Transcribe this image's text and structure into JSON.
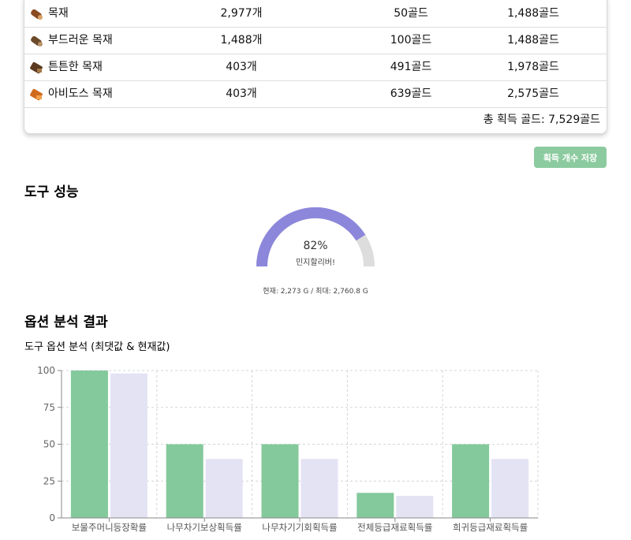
{
  "table": {
    "rows": [
      {
        "name": "목재",
        "count": "2,977개",
        "price": "50골드",
        "total": "1,488골드",
        "icon": "log-icon",
        "icon_color": "#8a4a22"
      },
      {
        "name": "부드러운 목재",
        "count": "1,488개",
        "price": "100골드",
        "total": "1,488골드",
        "icon": "soft-log-icon",
        "icon_color": "#6b4a2a"
      },
      {
        "name": "튼튼한 목재",
        "count": "403개",
        "price": "491골드",
        "total": "1,978골드",
        "icon": "sturdy-log-icon",
        "icon_color": "#5a3a20"
      },
      {
        "name": "아비도스 목재",
        "count": "403개",
        "price": "639골드",
        "total": "2,575골드",
        "icon": "abidos-log-icon",
        "icon_color": "#d06a1a"
      }
    ],
    "total_text": "총 획득 골드: 7,529골드"
  },
  "save_button_label": "획득 개수 저장",
  "tool_section": {
    "title": "도구 성능",
    "gauge_percent_text": "82%",
    "gauge_value": 0.82,
    "gauge_label": "민지할리버!",
    "current_text": "현재: 2,273 G / 최대: 2,760.8 G",
    "fill_color": "#8c87db",
    "track_color": "#dddddd"
  },
  "option_section": {
    "title": "옵션 분석 결과",
    "chart_title": "도구 옵션 분석 (최댓값 & 현재값)"
  },
  "chart_data": {
    "type": "bar",
    "title": "도구 옵션 분석 (최댓값 & 현재값)",
    "categories": [
      "보물주머니등장확률",
      "나무차기보상획득률",
      "나무차기기회획득률",
      "전체등급재료획득률",
      "희귀등급재료획득률"
    ],
    "series": [
      {
        "values": [
          100,
          50,
          50,
          17,
          50
        ],
        "color": "#84c99b"
      },
      {
        "values": [
          98,
          40,
          40,
          15,
          40
        ],
        "color": "#e4e3f4"
      }
    ],
    "ylim": [
      0,
      100
    ],
    "yticks": [
      0,
      25,
      50,
      75,
      100
    ],
    "grid": true
  }
}
